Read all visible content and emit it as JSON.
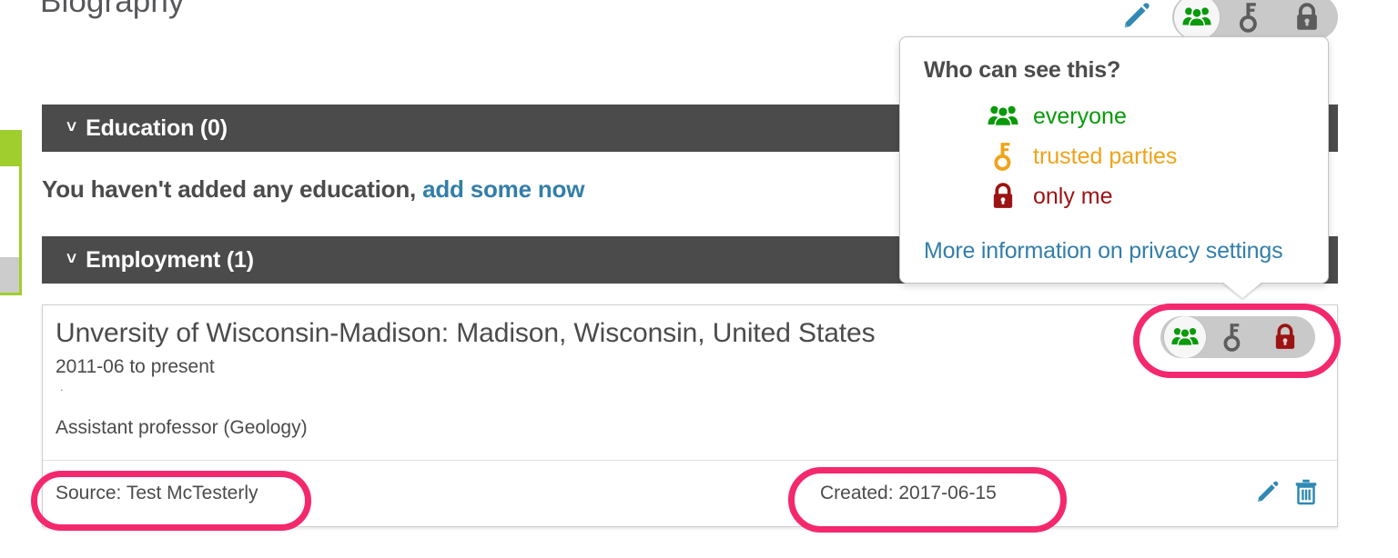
{
  "page": {
    "title": "Biography"
  },
  "top_toolbar": {
    "edit_icon": "pencil-icon",
    "privacy": {
      "selected": "everyone",
      "options": [
        "everyone",
        "trusted parties",
        "only me"
      ]
    }
  },
  "sections": [
    {
      "id": "education",
      "chevron": "˅",
      "title": "Education (0)",
      "empty_text": "You haven't added any education,",
      "empty_link": "add some now"
    },
    {
      "id": "employment",
      "chevron": "˅",
      "title": "Employment (1)"
    }
  ],
  "employment_card": {
    "title": "Unversity of Wisconsin-Madison: Madison, Wisconsin, United States",
    "dates": "2011-06 to present",
    "separator_dot": ".",
    "role": "Assistant professor (Geology)",
    "privacy": {
      "selected": "everyone",
      "options": [
        "everyone",
        "trusted parties",
        "only me"
      ]
    },
    "footer": {
      "source": "Source: Test McTesterly",
      "created": "Created: 2017-06-15",
      "edit_icon": "pencil-icon",
      "delete_icon": "trash-icon"
    }
  },
  "popover": {
    "heading": "Who can see this?",
    "options": [
      {
        "icon": "people-icon",
        "label": "everyone",
        "color": "#089a09"
      },
      {
        "icon": "key-icon",
        "label": "trusted parties",
        "color": "#f0a31a"
      },
      {
        "icon": "lock-icon",
        "label": "only me",
        "color": "#9c1313"
      }
    ],
    "link": "More information on privacy settings"
  },
  "annotations": [
    {
      "name": "employment-privacy-toolbar",
      "color": "#f4286e"
    },
    {
      "name": "source-label",
      "color": "#f4286e"
    },
    {
      "name": "created-label",
      "color": "#f4286e"
    }
  ],
  "colors": {
    "section_bar": "#4b4b4b",
    "link": "#337ea9",
    "accent_green": "#a0ce2e",
    "annotation": "#f4286e"
  }
}
